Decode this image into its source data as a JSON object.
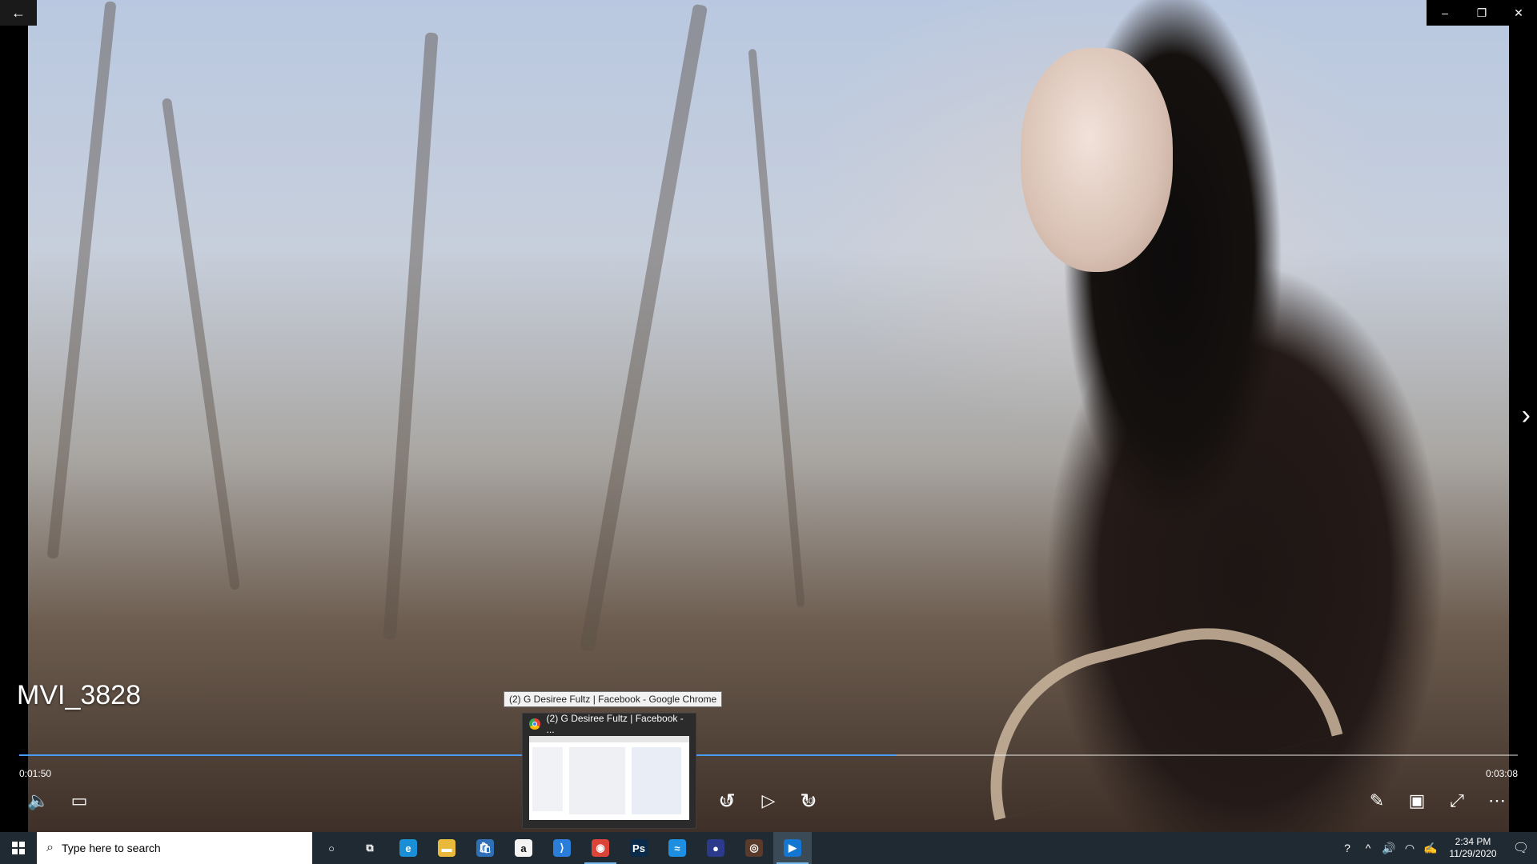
{
  "window": {
    "back_icon": "←",
    "minimize_icon": "–",
    "restore_icon": "❐",
    "close_icon": "✕",
    "next_icon": "›"
  },
  "video": {
    "title": "MVI_3828",
    "current_time": "0:01:50",
    "total_time": "0:03:08",
    "progress": 0.585,
    "accent_color": "#4a9cff"
  },
  "controls": {
    "volume_icon": "🔈",
    "subtitles_icon": "▭",
    "skip_back_seconds": "10",
    "play_icon": "▷",
    "skip_forward_seconds": "30",
    "edit_icon": "✎",
    "miniview_icon": "▣",
    "fullscreen_icon": "⤢",
    "more_icon": "⋯"
  },
  "tooltip": {
    "text": "(2) G Desiree Fultz | Facebook - Google Chrome"
  },
  "thumbnail": {
    "title": "(2) G Desiree Fultz | Facebook - ..."
  },
  "taskbar": {
    "search_placeholder": "Type here to search",
    "apps": [
      {
        "name": "cortana",
        "icon": "○",
        "color": "transparent"
      },
      {
        "name": "task-view",
        "icon": "⧉",
        "color": "transparent"
      },
      {
        "name": "edge",
        "icon": "e",
        "color": "#1b8fd6"
      },
      {
        "name": "file-explorer",
        "icon": "▬",
        "color": "#e8b93a"
      },
      {
        "name": "store",
        "icon": "🛍",
        "color": "#2f6fb6"
      },
      {
        "name": "amazon",
        "icon": "a",
        "color": "#f4f4f4"
      },
      {
        "name": "visual-studio",
        "icon": "⟩",
        "color": "#2a7dd8"
      },
      {
        "name": "chrome",
        "icon": "◉",
        "color": "#db4437"
      },
      {
        "name": "photoshop",
        "icon": "Ps",
        "color": "#0b2b4a"
      },
      {
        "name": "app-blue",
        "icon": "≈",
        "color": "#1e8ee0"
      },
      {
        "name": "app-orange",
        "icon": "●",
        "color": "#2c3a8c"
      },
      {
        "name": "media",
        "icon": "◎",
        "color": "#5a3a2a"
      },
      {
        "name": "movies-tv",
        "icon": "▶",
        "color": "#1476d0"
      }
    ],
    "time": "2:34 PM",
    "date": "11/29/2020",
    "tray_icons": [
      "?",
      "^",
      "🔊",
      "◠",
      "✍"
    ],
    "notification_icon": "🗨"
  }
}
